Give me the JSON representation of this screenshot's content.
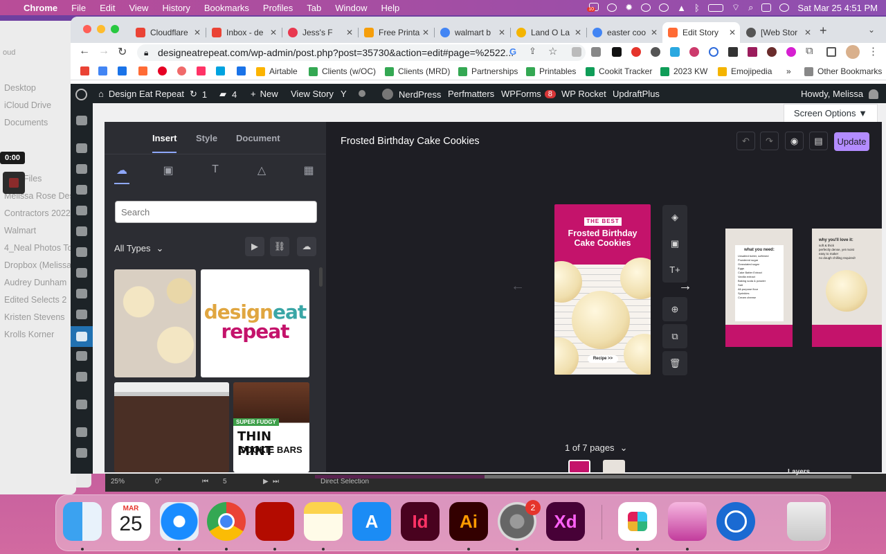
{
  "menubar": {
    "app": "Chrome",
    "items": [
      "File",
      "Edit",
      "View",
      "History",
      "Bookmarks",
      "Profiles",
      "Tab",
      "Window",
      "Help"
    ],
    "clock": "Sat Mar 25  4:51 PM",
    "calendar_badge": "10"
  },
  "finder": {
    "partial_header": "oud",
    "items": [
      "Desktop",
      "iCloud Drive",
      "Documents",
      "Files",
      "Melissa Rose Des",
      "Contractors 2022",
      "Walmart",
      "4_Neal Photos To",
      "Dropbox (Melissa",
      "Audrey Dunham",
      "Edited Selects 2",
      "Kristen Stevens",
      "Krolls Korner"
    ],
    "timer": "0:00"
  },
  "tabs": [
    {
      "label": "Cloudflare",
      "color": "#ea4335"
    },
    {
      "label": "Inbox - de",
      "color": "#ea4335"
    },
    {
      "label": "Jess's F",
      "color": "#e8384f"
    },
    {
      "label": "Free Printa",
      "color": "#f59e0b"
    },
    {
      "label": "walmart b",
      "color": "#4285f4"
    },
    {
      "label": "Land O La",
      "color": "#f4b400"
    },
    {
      "label": "easter coo",
      "color": "#4285f4"
    },
    {
      "label": "Edit Story",
      "color": "#ff6b35",
      "active": true
    },
    {
      "label": "[Web Stor",
      "color": "#555555"
    }
  ],
  "url": "designeatrepeat.com/wp-admin/post.php?post=35730&action=edit#page=%2522...",
  "bookmarks": [
    {
      "label": "",
      "color": "#ea4335"
    },
    {
      "label": "",
      "color": "#4285f4"
    },
    {
      "label": "",
      "color": "#1a73e8"
    },
    {
      "label": "",
      "color": "#ff6b35"
    },
    {
      "label": "",
      "color": "#e60023"
    },
    {
      "label": "",
      "color": "#f06a6a"
    },
    {
      "label": "",
      "color": "#ff3366"
    },
    {
      "label": "",
      "color": "#00a3e0"
    },
    {
      "label": "",
      "color": "#1a73e8"
    },
    {
      "label": "Airtable",
      "color": "#fcb400"
    },
    {
      "label": "Clients (w/OC)",
      "color": "#34a853"
    },
    {
      "label": "Clients (MRD)",
      "color": "#34a853"
    },
    {
      "label": "Partnerships",
      "color": "#34a853"
    },
    {
      "label": "Printables",
      "color": "#34a853"
    },
    {
      "label": "Cookit Tracker",
      "color": "#0f9d58"
    },
    {
      "label": "2023 KW",
      "color": "#0f9d58"
    },
    {
      "label": "Emojipedia",
      "color": "#f4b400"
    },
    {
      "label": "»",
      "color": ""
    },
    {
      "label": "Other Bookmarks",
      "color": "#888888"
    }
  ],
  "wpbar": {
    "site": "Design Eat Repeat",
    "updates": "1",
    "comments": "4",
    "new": "New",
    "view": "View Story",
    "nerdpress": "NerdPress",
    "perfmatters": "Perfmatters",
    "wpforms": "WPForms",
    "wpforms_badge": "8",
    "rocket": "WP Rocket",
    "updraft": "UpdraftPlus",
    "howdy": "Howdy, Melissa"
  },
  "screen_options": "Screen Options ▼",
  "editor": {
    "tabs": [
      "Insert",
      "Style",
      "Document"
    ],
    "search_placeholder": "Search",
    "all_types": "All Types",
    "story_title": "Frosted Birthday Cake Cookies",
    "update": "Update",
    "page_kicker": "THE BEST",
    "page_title": "Frosted Birthday Cake Cookies",
    "recipe_btn": "Recipe >>",
    "pages_label": "1 of 7 pages",
    "thumb_logo_1": "design",
    "thumb_logo_2": "eat",
    "thumb_logo_3": "repeat",
    "thumb_badge": "SUPER FUDGY",
    "thumb_title_1": "THIN MINT",
    "thumb_title_2": "COOKIE BARS",
    "page2_heading": "what you need:",
    "page2_items": [
      "Unsalted butter, softened",
      "Powdered sugar",
      "Granulated sugar",
      "Eggs",
      "Cake Batter Extract",
      "Vanilla extract",
      "Baking soda & powder",
      "Salt",
      "All-purpose flour",
      "Sprinkles",
      "Cream cheese"
    ],
    "page3_heading": "why you'll love it:",
    "page3_items": [
      "soft & thick",
      "perfectly dense, yet moist",
      "easy to make!",
      "no dough chilling required!"
    ]
  },
  "underbar": {
    "zoom": "25%",
    "angle": "0°",
    "page": "5",
    "tool": "Direct Selection",
    "panel": "Layers"
  },
  "dock": {
    "calendar_month": "MAR",
    "calendar_day": "25",
    "settings_badge": "2",
    "apps": [
      "finder-icon",
      "calendar-icon",
      "safari-icon",
      "chrome-icon",
      "acrobat-icon",
      "notes-icon",
      "app-store-icon",
      "indesign-icon",
      "illustrator-icon",
      "system-preferences-icon",
      "xd-icon",
      "slack-icon",
      "klokki-icon",
      "onepassword-icon",
      "trash-icon"
    ],
    "id_label": "Id",
    "ai_label": "Ai",
    "xd_label": "Xd"
  }
}
